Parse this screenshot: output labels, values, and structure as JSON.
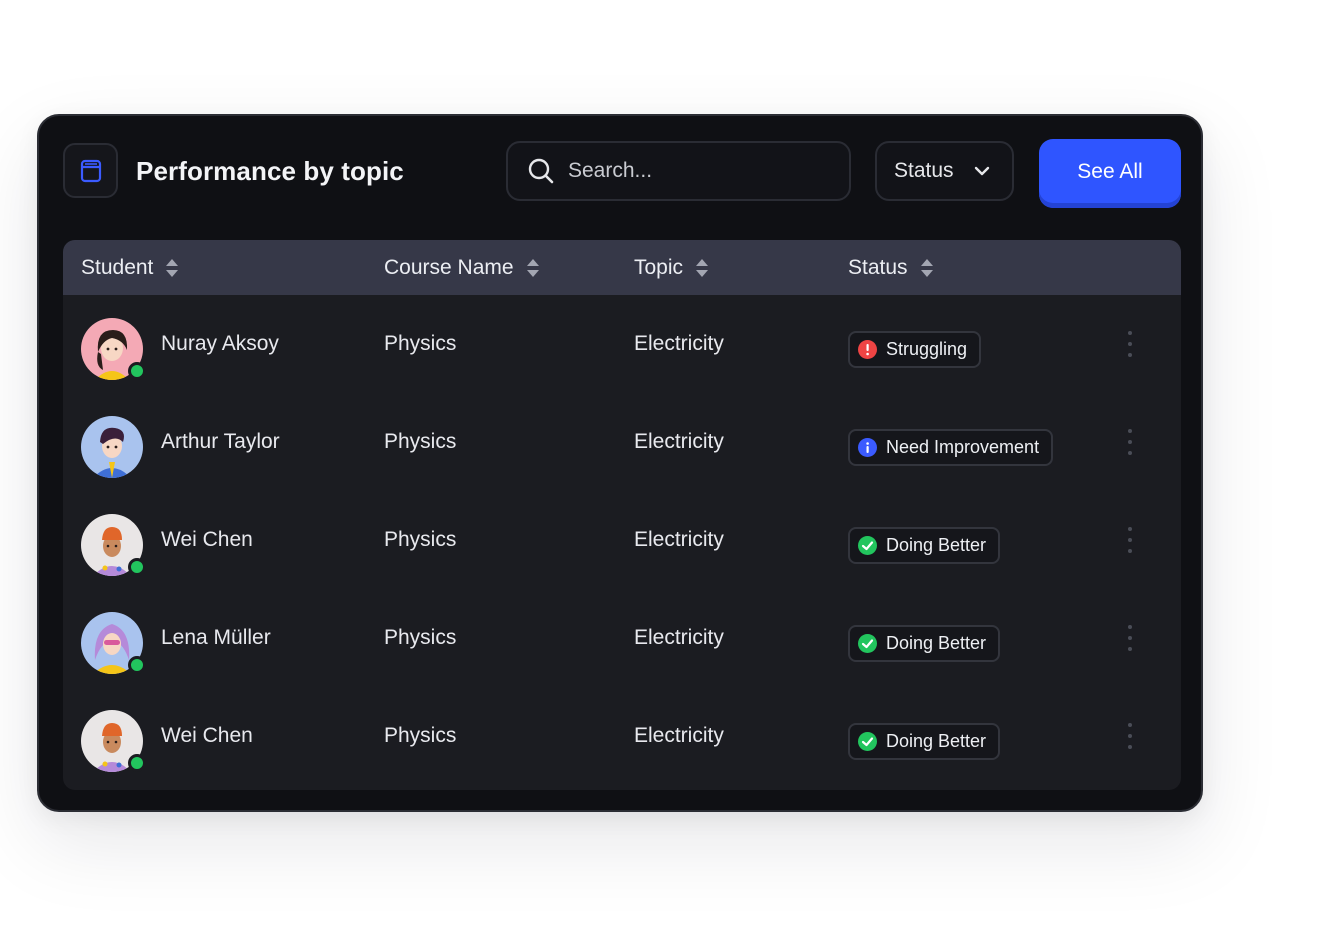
{
  "header": {
    "title": "Performance by topic",
    "title_icon": "book-icon",
    "search_placeholder": "Search...",
    "status_label": "Status",
    "see_all_label": "See All"
  },
  "colors": {
    "accent": "#2f55ff",
    "card_bg": "#0f1014",
    "table_bg": "#1b1c21",
    "header_bg": "#363848",
    "online": "#22c55e",
    "struggling": "#ef4444",
    "need_improvement": "#3b5bff",
    "doing_better": "#22c55e"
  },
  "table": {
    "columns": [
      "Student",
      "Course Name",
      "Topic",
      "Status"
    ],
    "rows": [
      {
        "student": "Nuray Aksoy",
        "course": "Physics",
        "topic": "Electricity",
        "status": "Struggling",
        "status_kind": "error",
        "online": true,
        "avatar": "avatar-nuray"
      },
      {
        "student": "Arthur Taylor",
        "course": "Physics",
        "topic": "Electricity",
        "status": "Need Improvement",
        "status_kind": "info",
        "online": false,
        "avatar": "avatar-arthur"
      },
      {
        "student": "Wei Chen",
        "course": "Physics",
        "topic": "Electricity",
        "status": "Doing Better",
        "status_kind": "success",
        "online": true,
        "avatar": "avatar-wei"
      },
      {
        "student": "Lena Müller",
        "course": "Physics",
        "topic": "Electricity",
        "status": "Doing Better",
        "status_kind": "success",
        "online": true,
        "avatar": "avatar-lena"
      },
      {
        "student": "Wei Chen",
        "course": "Physics",
        "topic": "Electricity",
        "status": "Doing Better",
        "status_kind": "success",
        "online": true,
        "avatar": "avatar-wei"
      }
    ]
  }
}
